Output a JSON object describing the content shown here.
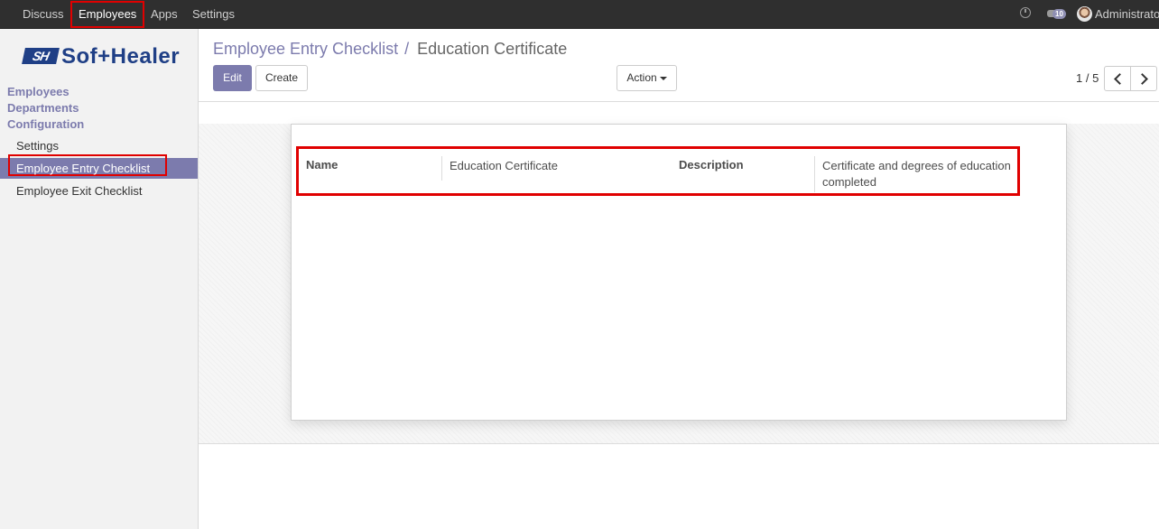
{
  "topbar": {
    "menu": [
      "Discuss",
      "Employees",
      "Apps",
      "Settings"
    ],
    "active_menu": "Employees",
    "chat_count": "10",
    "user": "Administrator"
  },
  "sidebar": {
    "logo_mark": "SH",
    "logo_text": "Sof+Healer",
    "sections": [
      "Employees",
      "Departments",
      "Configuration"
    ],
    "config_items": [
      "Settings",
      "Employee Entry Checklist",
      "Employee Exit Checklist"
    ],
    "active_item": "Employee Entry Checklist"
  },
  "breadcrumb": {
    "parent": "Employee Entry Checklist",
    "separator": "/",
    "current": "Education Certificate"
  },
  "buttons": {
    "edit": "Edit",
    "create": "Create",
    "action": "Action"
  },
  "pager": {
    "text": "1 / 5"
  },
  "form": {
    "name_label": "Name",
    "name_value": "Education Certificate",
    "description_label": "Description",
    "description_value": "Certificate and degrees of education completed"
  },
  "colors": {
    "brand": "#7c7bad",
    "topbar": "#2f2f2f",
    "highlight": "#e00000"
  }
}
